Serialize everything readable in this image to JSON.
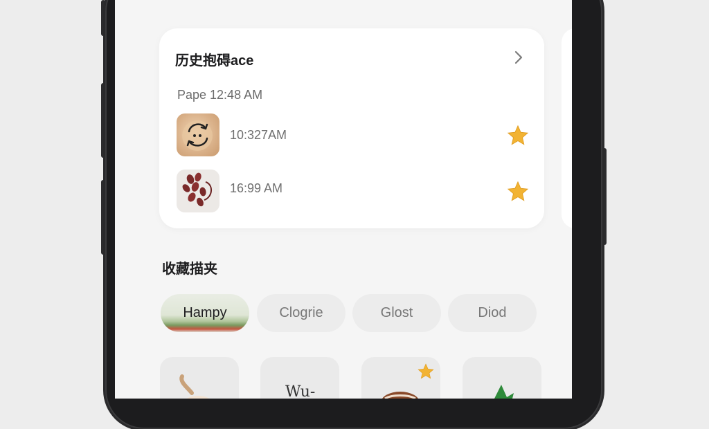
{
  "history": {
    "title": "历史抱碍ace",
    "subtitle": "Pape 12:48 AM",
    "items": [
      {
        "time": "10:327AM",
        "favorited": true
      },
      {
        "time": "16:99 AM",
        "favorited": true
      }
    ]
  },
  "favorites": {
    "title": "收藏描夹",
    "chips": [
      "Hampy",
      "Clogrie",
      "Glost",
      "Diod"
    ],
    "tiles": [
      {
        "label": ""
      },
      {
        "label": "Wu-"
      },
      {
        "label": "",
        "favorited": true
      },
      {
        "label": ""
      }
    ]
  },
  "colors": {
    "star": "#f2b333",
    "screen_bg": "#f5f5f5",
    "card_bg": "#ffffff",
    "chip_bg": "#ececec"
  },
  "icons": [
    "chevron-right-icon",
    "star-icon"
  ]
}
